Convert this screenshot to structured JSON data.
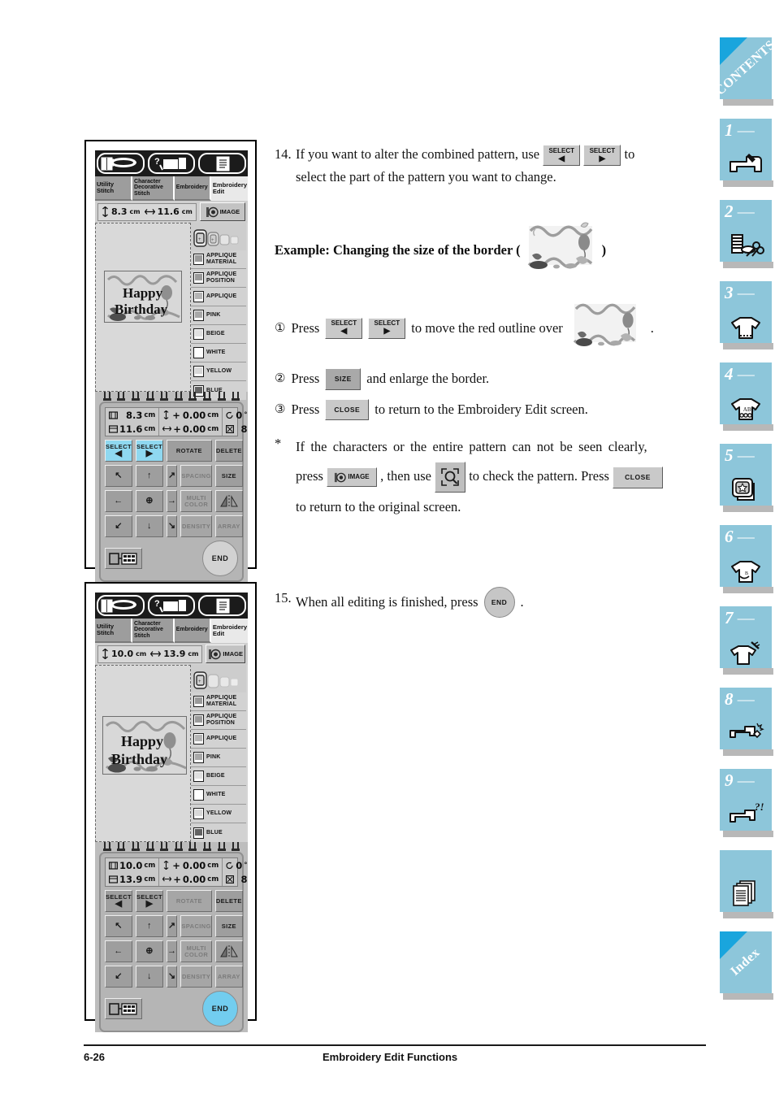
{
  "footer": {
    "page_number": "6-26",
    "title": "Embroidery Edit Functions"
  },
  "sidebar": {
    "tabs": [
      {
        "name": "contents",
        "label": "CONTENTS",
        "number": "",
        "icon": "contents-corner"
      },
      {
        "name": "chapter-1",
        "label": "",
        "number": "1",
        "icon": "sewing-machine-icon"
      },
      {
        "name": "chapter-2",
        "label": "",
        "number": "2",
        "icon": "thread-spool-scissors-icon"
      },
      {
        "name": "chapter-3",
        "label": "",
        "number": "3",
        "icon": "tshirt-stitch-icon"
      },
      {
        "name": "chapter-4",
        "label": "",
        "number": "4",
        "icon": "tshirt-abc-icon"
      },
      {
        "name": "chapter-5",
        "label": "",
        "number": "5",
        "icon": "embroidery-card-star-icon"
      },
      {
        "name": "chapter-6",
        "label": "",
        "number": "6",
        "icon": "tshirt-monogram-icon"
      },
      {
        "name": "chapter-7",
        "label": "",
        "number": "7",
        "icon": "tshirt-needle-icon"
      },
      {
        "name": "chapter-8",
        "label": "",
        "number": "8",
        "icon": "machine-maintenance-icon"
      },
      {
        "name": "chapter-9",
        "label": "",
        "number": "9",
        "icon": "machine-troubleshoot-icon"
      },
      {
        "name": "appendix",
        "label": "",
        "number": "",
        "icon": "documents-icon"
      },
      {
        "name": "index",
        "label": "Index",
        "number": "",
        "icon": "index-corner"
      }
    ],
    "accent_color": "#8dc6da",
    "corner_color": "#19a5dd"
  },
  "screens": [
    {
      "id": "screen-top",
      "tabs": [
        {
          "label": "Utility\nStitch",
          "active": false
        },
        {
          "label": "Character\nDecorative\nStitch",
          "active": false
        },
        {
          "label": "Embroidery",
          "active": false
        },
        {
          "label": "Embroidery\nEdit",
          "active": true
        }
      ],
      "size": {
        "height": "8.3",
        "width": "11.6",
        "unit": "cm"
      },
      "image_button": "IMAGE",
      "design_text_line1": "Happy",
      "design_text_line2": "Birthday",
      "colors": [
        {
          "label": "APPLIQUE\nMATERIAL",
          "swatch": "#9a9a9a"
        },
        {
          "label": "APPLIQUE\nPOSITION",
          "swatch": "#9a9a9a"
        },
        {
          "label": "APPLIQUE",
          "swatch": "#b4b4b4"
        },
        {
          "label": "PINK",
          "swatch": "#a8a8a8"
        },
        {
          "label": "BEIGE",
          "swatch": "#e0e0e0"
        },
        {
          "label": "WHITE",
          "swatch": "#ffffff"
        },
        {
          "label": "YELLOW",
          "swatch": "#d8d8d8"
        },
        {
          "label": "BLUE",
          "swatch": "#636363"
        }
      ],
      "readout": {
        "height": "8.3",
        "width": "11.6",
        "unit": "cm",
        "offset_v": "0.00",
        "offset_h": "0.00",
        "offset_unit": "cm",
        "rotation": "0",
        "rotation_unit": "°",
        "color_count": "8"
      },
      "buttons": {
        "select_left": "SELECT",
        "select_right": "SELECT",
        "rotate": "ROTATE",
        "delete": "DELETE",
        "spacing": "SPACING",
        "size": "SIZE",
        "multi_color": "MULTI\nCOLOR",
        "density": "DENSITY",
        "array": "ARRAY",
        "end": "END"
      },
      "select_highlighted": true,
      "end_highlighted": false
    },
    {
      "id": "screen-bottom",
      "tabs": [
        {
          "label": "Utility\nStitch",
          "active": false
        },
        {
          "label": "Character\nDecorative\nStitch",
          "active": false
        },
        {
          "label": "Embroidery",
          "active": false
        },
        {
          "label": "Embroidery\nEdit",
          "active": true
        }
      ],
      "size": {
        "height": "10.0",
        "width": "13.9",
        "unit": "cm"
      },
      "image_button": "IMAGE",
      "design_text_line1": "Happy",
      "design_text_line2": "Birthday",
      "colors": [
        {
          "label": "APPLIQUE\nMATERIAL",
          "swatch": "#9a9a9a"
        },
        {
          "label": "APPLIQUE\nPOSITION",
          "swatch": "#9a9a9a"
        },
        {
          "label": "APPLIQUE",
          "swatch": "#b4b4b4"
        },
        {
          "label": "PINK",
          "swatch": "#a8a8a8"
        },
        {
          "label": "BEIGE",
          "swatch": "#e0e0e0"
        },
        {
          "label": "WHITE",
          "swatch": "#ffffff"
        },
        {
          "label": "YELLOW",
          "swatch": "#d8d8d8"
        },
        {
          "label": "BLUE",
          "swatch": "#636363"
        }
      ],
      "readout": {
        "height": "10.0",
        "width": "13.9",
        "unit": "cm",
        "offset_v": "0.00",
        "offset_h": "0.00",
        "offset_unit": "cm",
        "rotation": "0",
        "rotation_unit": "°",
        "color_count": "8"
      },
      "buttons": {
        "select_left": "SELECT",
        "select_right": "SELECT",
        "rotate": "ROTATE",
        "delete": "DELETE",
        "spacing": "SPACING",
        "size": "SIZE",
        "multi_color": "MULTI\nCOLOR",
        "density": "DENSITY",
        "array": "ARRAY",
        "end": "END"
      },
      "select_highlighted": false,
      "end_highlighted": true
    }
  ],
  "body": {
    "step14": {
      "number": "14.",
      "part1": "If you want to alter the combined pattern, use",
      "part2": "to",
      "part3": "select the part of the pattern you want to change."
    },
    "example_heading_start": "Example: Changing the size of the border (",
    "example_heading_end": ")",
    "sub_steps": [
      {
        "marker": "①",
        "press": "Press",
        "tail": "to move the red outline over",
        "tail2": "."
      },
      {
        "marker": "②",
        "press": "Press",
        "tail": "and enlarge the border."
      },
      {
        "marker": "③",
        "press": "Press",
        "tail": "to return to the Embroidery Edit screen."
      }
    ],
    "note": {
      "marker": "*",
      "line1": "If the characters or the entire pattern can not be seen clearly,",
      "line2a": "press",
      "line2b": ", then use",
      "line2c": "to check the pattern. Press",
      "line3": "to return to the original screen."
    },
    "step15": {
      "number": "15.",
      "text": "When all editing is finished, press",
      "tail": "."
    },
    "keys": {
      "select": "SELECT",
      "size": "SIZE",
      "close": "CLOSE",
      "image": "IMAGE",
      "end": "END",
      "magnify": "magnify-icon"
    }
  }
}
